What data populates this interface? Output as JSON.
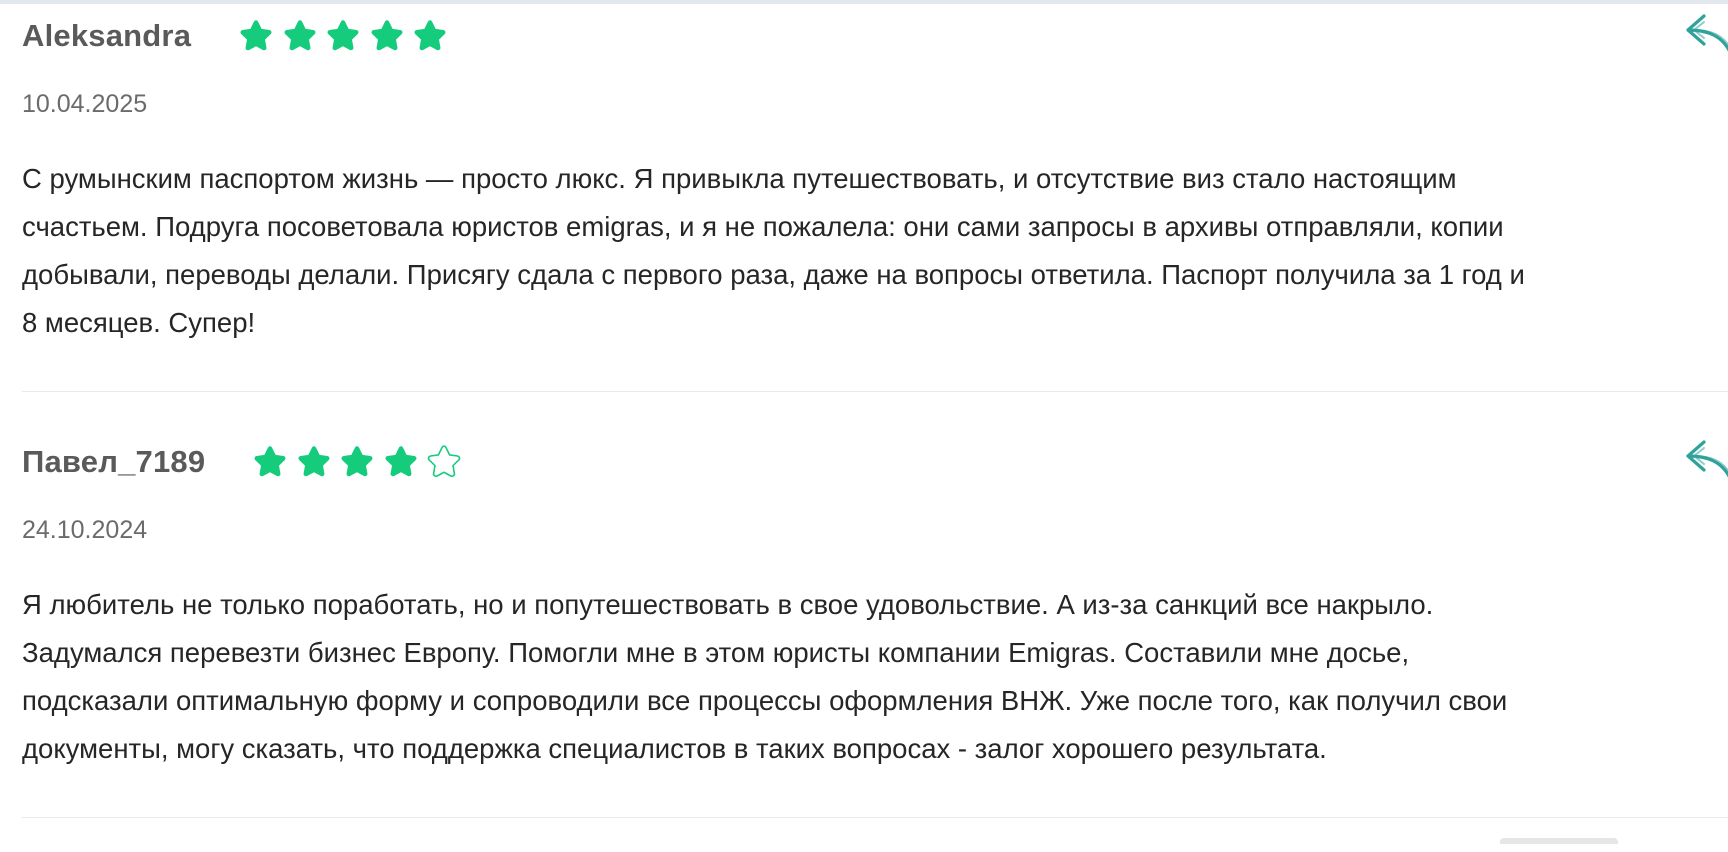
{
  "theme": {
    "star_color": "#14cc7c",
    "reply_icon_color": "#2fa39a",
    "divider_color": "#e9e9e9"
  },
  "reviews": [
    {
      "author": "Aleksandra",
      "rating": 5,
      "max_rating": 5,
      "date": "10.04.2025",
      "text": "С румынским паспортом жизнь — просто люкс. Я привыкла путешествовать, и отсутствие виз стало настоящим\nсчастьем. Подруга посоветовала юристов emigras, и я не пожалела: они сами запросы в архивы отправляли, копии\nдобывали, переводы делали. Присягу сдала с первого раза, даже на вопросы ответила. Паспорт получила за 1 год и\n8 месяцев. Супер!",
      "reply_icon": "reply-arrow-icon"
    },
    {
      "author": "Павел_7189",
      "rating": 4,
      "max_rating": 5,
      "date": "24.10.2024",
      "text": "Я любитель не только поработать, но и попутешествовать в свое удовольствие. А из-за санкций все накрыло.\nЗадумался перевезти бизнес Европу. Помогли мне в этом юристы компании Emigras. Составили мне досье,\nподсказали оптимальную форму и сопроводили все процессы оформления ВНЖ. Уже после того, как получил свои\nдокументы, могу сказать, что поддержка специалистов в таких вопросах - залог хорошего результата.",
      "reply_icon": "reply-arrow-icon"
    }
  ]
}
